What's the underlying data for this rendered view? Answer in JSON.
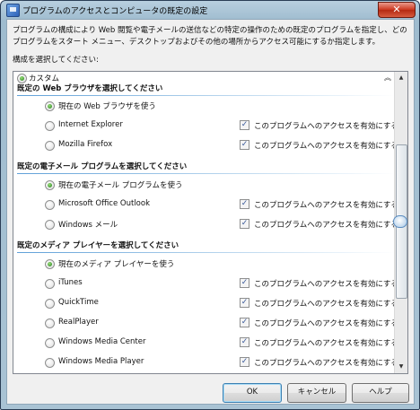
{
  "window": {
    "title": "プログラムのアクセスとコンピュータの既定の設定",
    "close_label": "✕"
  },
  "description": "プログラムの構成により Web 閲覧や電子メールの送信などの特定の操作のための既定のプログラムを指定し、どのプログラムをスタート メニュー、デスクトップおよびその他の場所からアクセス可能にするか指定します。",
  "prompt": "構成を選択してください:",
  "configuration": {
    "label": "カスタム",
    "collapse_icon": "double-chevron-up"
  },
  "access_label": "このプログラムへのアクセスを有効にする",
  "groups": [
    {
      "heading": "既定の Web ブラウザを選択してください",
      "options": [
        {
          "label": "現在の Web ブラウザを使う",
          "selected": true,
          "has_checkbox": false
        },
        {
          "label": "Internet Explorer",
          "selected": false,
          "has_checkbox": true,
          "checked": true
        },
        {
          "label": "Mozilla Firefox",
          "selected": false,
          "has_checkbox": true,
          "checked": true
        }
      ]
    },
    {
      "heading": "既定の電子メール プログラムを選択してください",
      "options": [
        {
          "label": "現在の電子メール プログラムを使う",
          "selected": true,
          "has_checkbox": false
        },
        {
          "label": "Microsoft Office Outlook",
          "selected": false,
          "has_checkbox": true,
          "checked": true
        },
        {
          "label": "Windows メール",
          "selected": false,
          "has_checkbox": true,
          "checked": true
        }
      ]
    },
    {
      "heading": "既定のメディア プレイヤーを選択してください",
      "options": [
        {
          "label": "現在のメディア プレイヤーを使う",
          "selected": true,
          "has_checkbox": false
        },
        {
          "label": "iTunes",
          "selected": false,
          "has_checkbox": true,
          "checked": true
        },
        {
          "label": "QuickTime",
          "selected": false,
          "has_checkbox": true,
          "checked": true
        },
        {
          "label": "RealPlayer",
          "selected": false,
          "has_checkbox": true,
          "checked": true
        },
        {
          "label": "Windows Media Center",
          "selected": false,
          "has_checkbox": true,
          "checked": true
        },
        {
          "label": "Windows Media Player",
          "selected": false,
          "has_checkbox": true,
          "checked": true
        }
      ]
    }
  ],
  "buttons": {
    "ok": "OK",
    "cancel": "キャンセル",
    "help": "ヘルプ"
  },
  "colors": {
    "accent": "#3c7fb1",
    "radio_selected": "#1f7a1b",
    "close_button": "#c8361e"
  }
}
